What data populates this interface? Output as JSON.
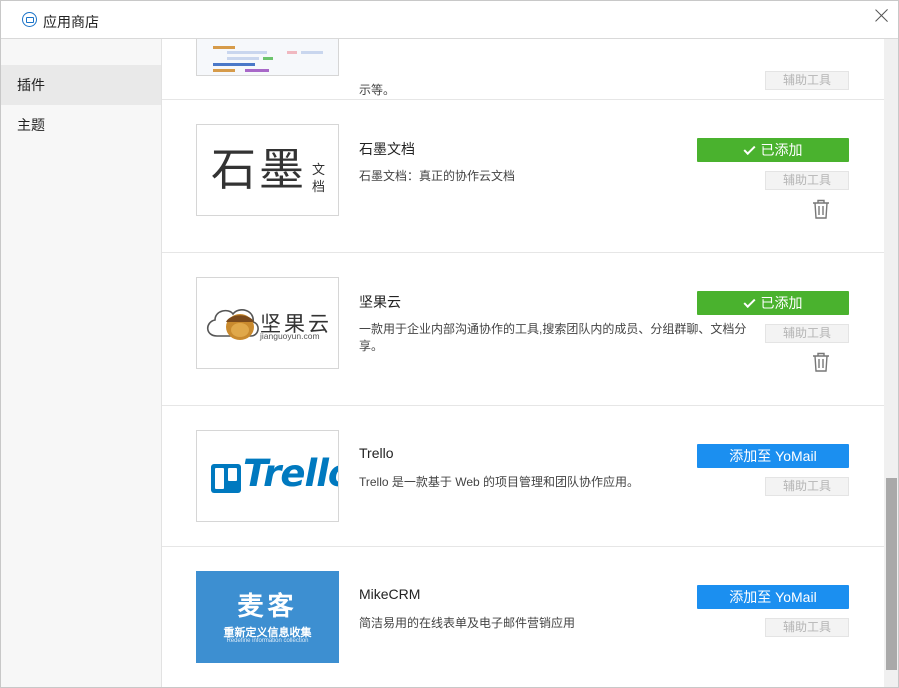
{
  "window": {
    "title": "应用商店"
  },
  "sidebar": {
    "items": [
      {
        "label": "插件"
      },
      {
        "label": "主题"
      }
    ]
  },
  "plugins": [
    {
      "name": "",
      "description": "示等。",
      "button_label": "",
      "tool_label": "辅助工具"
    },
    {
      "name": "石墨文档",
      "description": "石墨文档：真正的协作云文档",
      "logo_main": "石墨",
      "logo_side": [
        "文",
        "档"
      ],
      "status": "added",
      "button_label": "已添加",
      "tool_label": "辅助工具"
    },
    {
      "name": "坚果云",
      "description": "一款用于企业内部沟通协作的工具,搜索团队内的成员、分组群聊、文档分享。",
      "logo_main": "坚果云",
      "logo_sub": "jianguoyun.com",
      "status": "added",
      "button_label": "已添加",
      "tool_label": "辅助工具"
    },
    {
      "name": "Trello",
      "description": "Trello 是一款基于 Web 的项目管理和团队协作应用。",
      "logo_text": "Trello",
      "status": "not_added",
      "button_label": "添加至 YoMail",
      "tool_label": "辅助工具"
    },
    {
      "name": "MikeCRM",
      "description": "简洁易用的在线表单及电子邮件营销应用",
      "logo_main": "麦客",
      "logo_sub": "重新定义信息收集",
      "logo_en": "Redefine information collection",
      "status": "not_added",
      "button_label": "添加至 YoMail",
      "tool_label": "辅助工具"
    }
  ],
  "colors": {
    "added_green": "#4ab22e",
    "add_blue": "#1b8ff0",
    "trello_blue": "#0079bf",
    "mikecrm_blue": "#3d8fd1"
  }
}
